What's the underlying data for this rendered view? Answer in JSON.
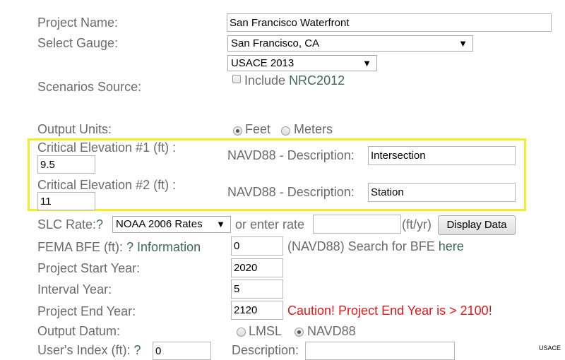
{
  "form": {
    "project_name": {
      "label": "Project Name:",
      "value": "San Francisco Waterfront"
    },
    "gauge": {
      "label": "Select Gauge:",
      "value": "San Francisco, CA"
    },
    "scenarios": {
      "label": "Scenarios Source:",
      "value": "USACE 2013",
      "include_prefix": "Include",
      "include_link": "NRC2012"
    },
    "output_units": {
      "label": "Output Units:",
      "options": [
        "Feet",
        "Meters"
      ],
      "selected": "Feet"
    },
    "critical1": {
      "label": "Critical Elevation #1 (ft) :",
      "value": "9.5",
      "desc_label": "NAVD88 - Description:",
      "desc_value": "Intersection"
    },
    "critical2": {
      "label": "Critical Elevation #2 (ft) :",
      "value": "11",
      "desc_label": "NAVD88 - Description:",
      "desc_value": "Station"
    },
    "slc_rate": {
      "label_prefix": "SLC Rate:",
      "label_help": "?",
      "select_value": "NOAA 2006 Rates",
      "or_text": "or enter rate",
      "rate_value": "",
      "unit_text": "(ft/yr)",
      "button": "Display Data"
    },
    "fema_bfe": {
      "label_prefix": "FEMA BFE (ft):",
      "label_link": "? Information",
      "value": "0",
      "suffix_text": "(NAVD88) Search for BFE",
      "suffix_link": "here"
    },
    "start_year": {
      "label": "Project Start Year:",
      "value": "2020"
    },
    "interval_year": {
      "label": "Interval Year:",
      "value": "5"
    },
    "end_year": {
      "label": "Project End Year:",
      "value": "2120",
      "warning": "Caution! Project End Year is > 2100!"
    },
    "output_datum": {
      "label": "Output Datum:",
      "options": [
        "LMSL",
        "NAVD88"
      ],
      "selected": "NAVD88"
    },
    "users_index": {
      "label_prefix": "User's Index (ft):",
      "label_link": "?",
      "value": "0",
      "desc_label": "Description:",
      "desc_value": ""
    }
  },
  "credit": "USACE",
  "colors": {
    "label": "#6b6b6b",
    "link": "#3d6b56",
    "warning": "#e01818",
    "highlight": "#f2ef2a"
  }
}
